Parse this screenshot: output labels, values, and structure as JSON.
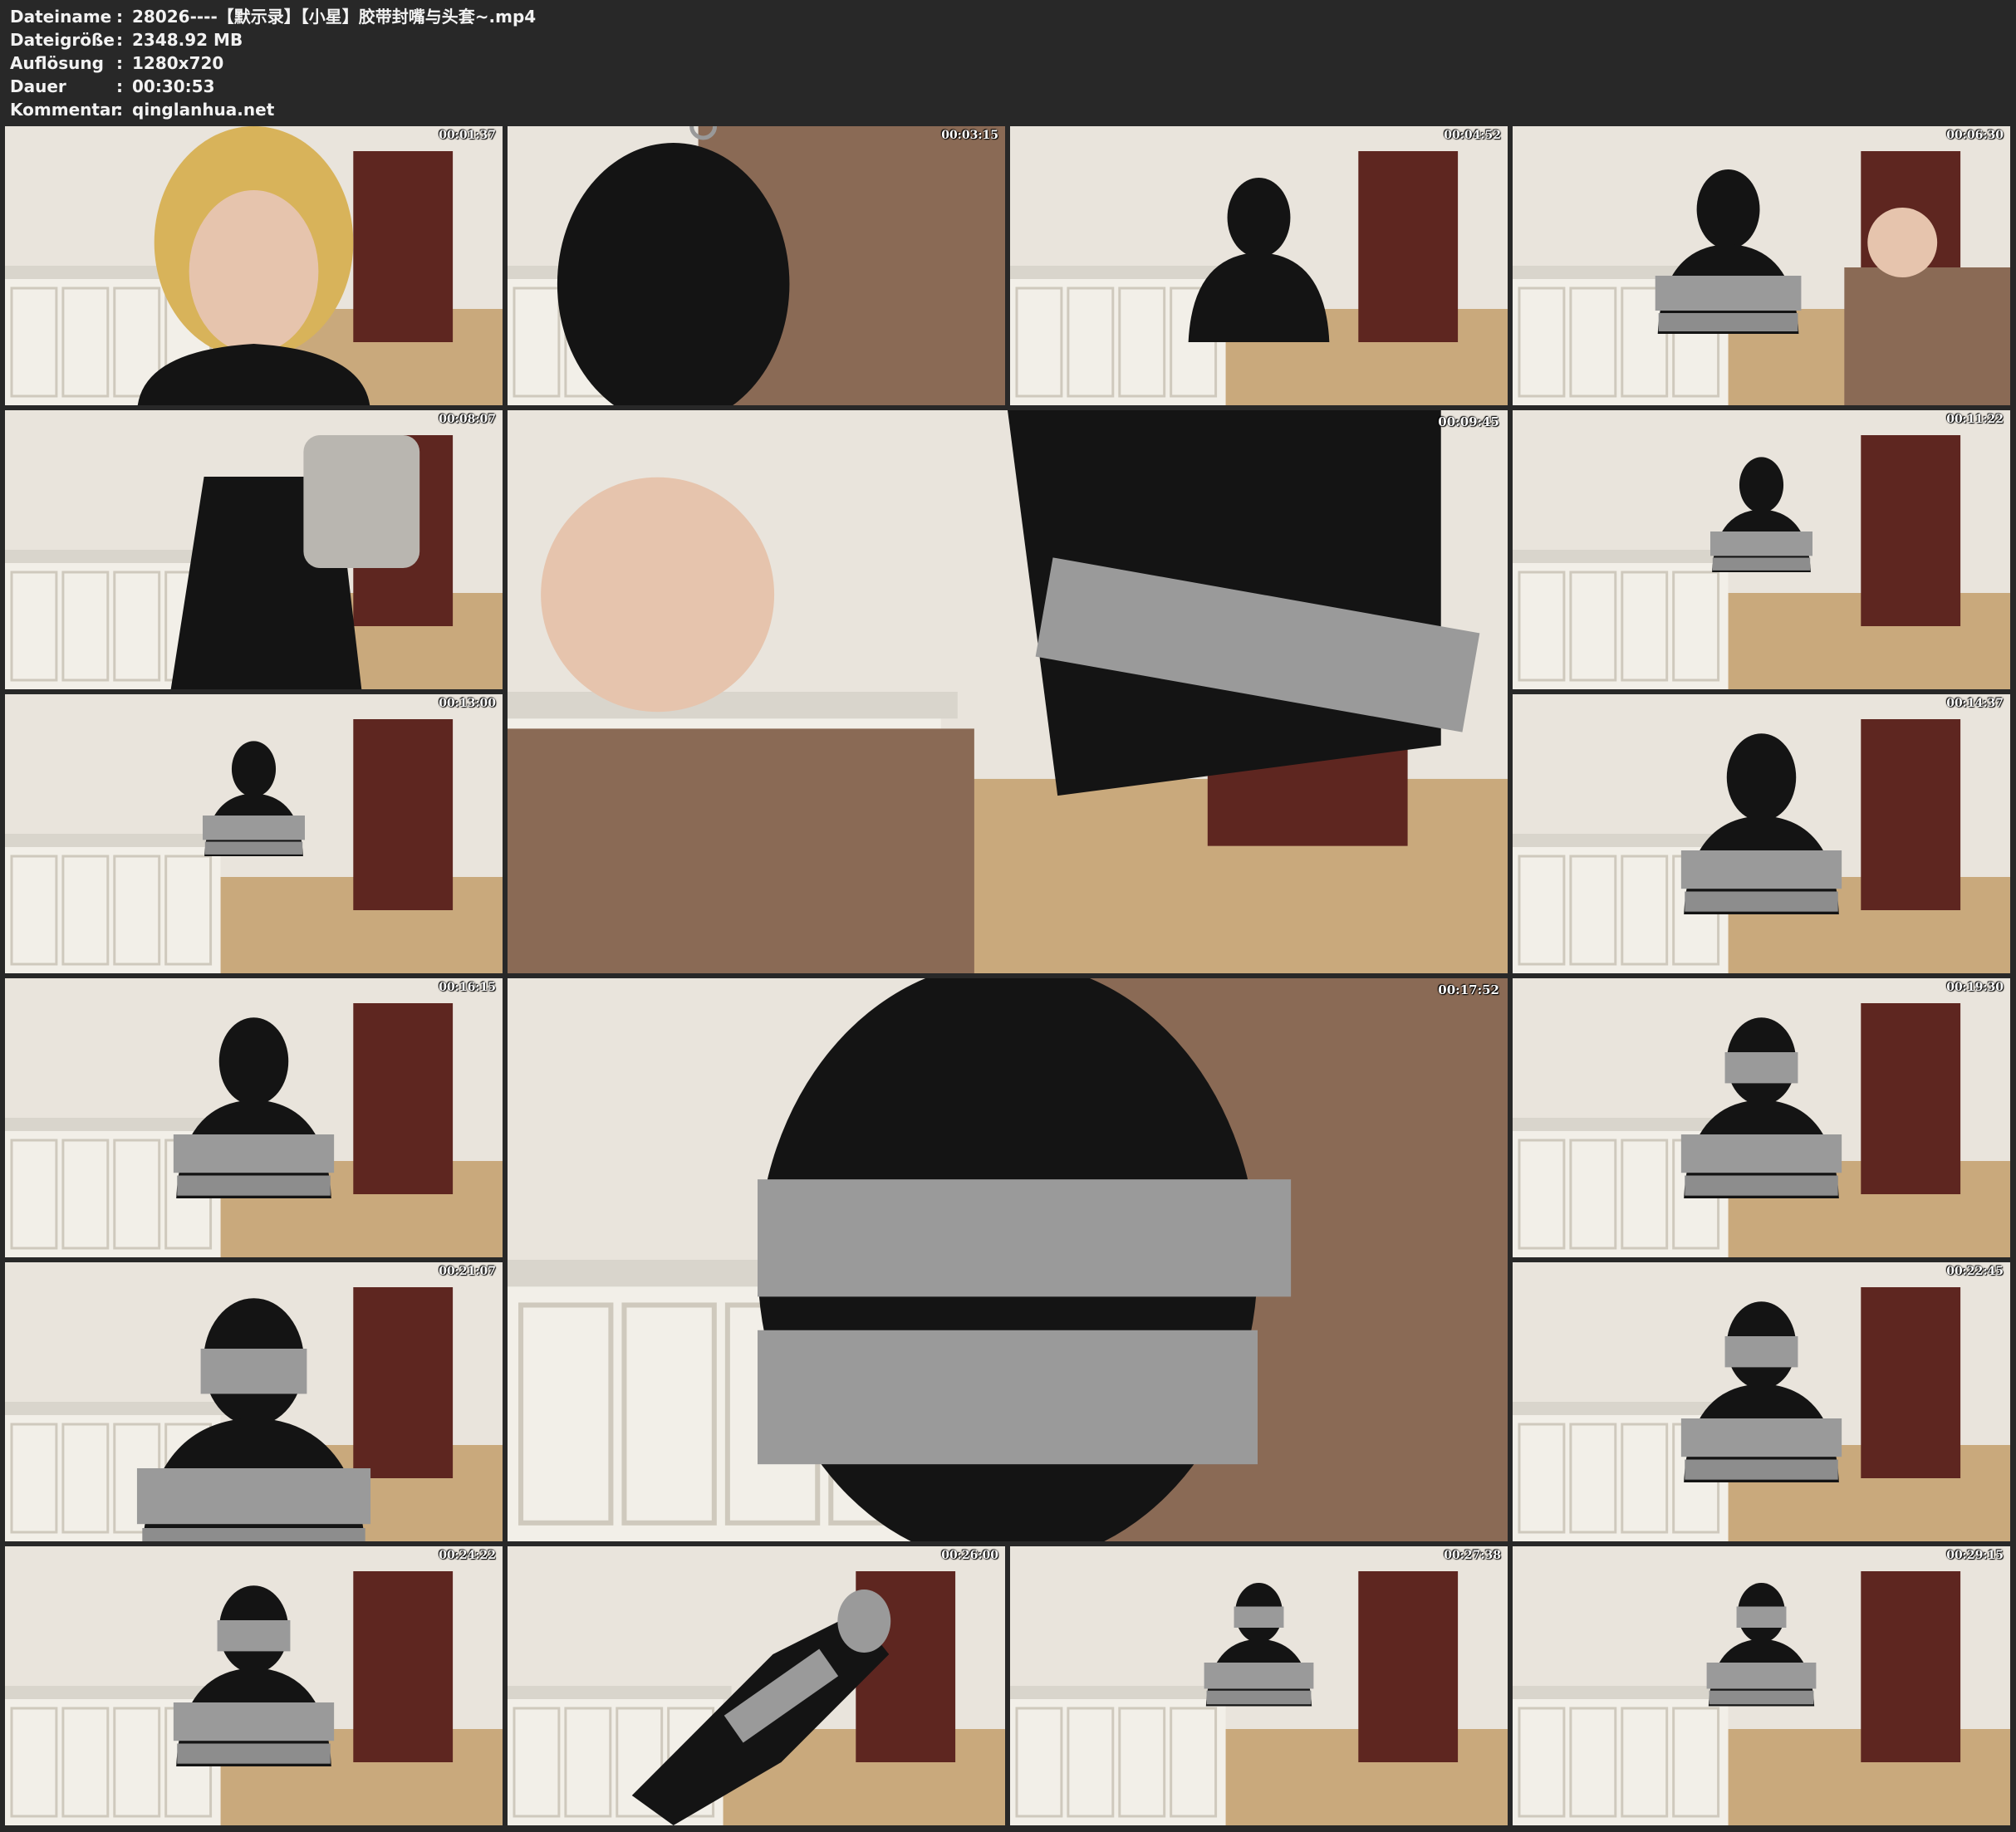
{
  "info": [
    {
      "label": "Dateiname",
      "sep": ":",
      "value": "28026----【默示录】【小星】胶带封嘴与头套~.mp4"
    },
    {
      "label": "Dateigröße",
      "sep": ":",
      "value": "2348.92 MB"
    },
    {
      "label": "Auflösung",
      "sep": ":",
      "value": "1280x720"
    },
    {
      "label": "Dauer",
      "sep": ":",
      "value": "00:30:53"
    },
    {
      "label": "Kommentar",
      "sep": ":",
      "value": "qinglanhua.net"
    }
  ],
  "thumbnails": [
    {
      "time": "00:01:37",
      "scene": "face-closeup"
    },
    {
      "time": "00:03:15",
      "scene": "hood-closeup"
    },
    {
      "time": "00:04:52",
      "scene": "hooded-seated"
    },
    {
      "time": "00:06:30",
      "scene": "hooded-taped-helper"
    },
    {
      "time": "00:08:07",
      "scene": "legs-seated"
    },
    {
      "time": "00:09:45",
      "scene": "taping-knees"
    },
    {
      "time": "00:11:22",
      "scene": "room-wide"
    },
    {
      "time": "00:13:00",
      "scene": "room-wide"
    },
    {
      "time": "00:14:37",
      "scene": "hooded-taped"
    },
    {
      "time": "00:16:15",
      "scene": "hooded-taped"
    },
    {
      "time": "00:17:52",
      "scene": "head-taping"
    },
    {
      "time": "00:19:30",
      "scene": "head-taped"
    },
    {
      "time": "00:21:07",
      "scene": "head-taped-close"
    },
    {
      "time": "00:22:45",
      "scene": "head-taped"
    },
    {
      "time": "00:24:22",
      "scene": "head-taped"
    },
    {
      "time": "00:26:00",
      "scene": "reclined-taped"
    },
    {
      "time": "00:27:38",
      "scene": "room-wide-taped"
    },
    {
      "time": "00:29:15",
      "scene": "room-wide-taped"
    }
  ],
  "colors": {
    "background": "#282828",
    "text": "#f2f2f2",
    "suit": "#141414",
    "tape": "#9a9a9a",
    "wall": "#e9e4dc",
    "floor": "#c9a97c",
    "cabinet": "#f2efe8",
    "door": "#5e2620"
  }
}
